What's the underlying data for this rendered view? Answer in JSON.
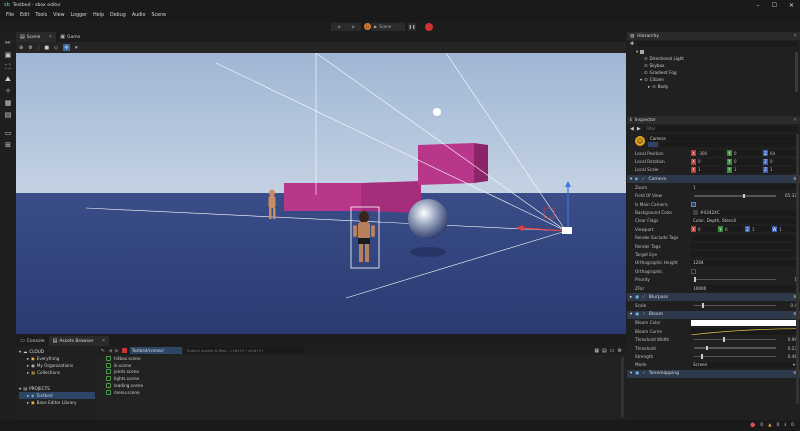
{
  "window": {
    "title": "Testbed - sbox editor"
  },
  "menu": [
    "File",
    "Edit",
    "Tools",
    "View",
    "Logger",
    "Help",
    "Debug",
    "Audio",
    "Scene"
  ],
  "playbar": {
    "scene_label": "Scene"
  },
  "viewport": {
    "tabs": [
      {
        "label": "Scene"
      },
      {
        "label": "Game"
      }
    ]
  },
  "bottom": {
    "tabs": [
      {
        "label": "Console"
      },
      {
        "label": "Assets Browser"
      }
    ],
    "path": "Testbed/scenes/",
    "search_placeholder": "Search assets & files... (ctrl+F / cmd+F)",
    "left": {
      "cloud_label": "CLOUD",
      "cloud_items": [
        "Everything",
        "My Organizations",
        "Collections"
      ],
      "projects_label": "PROJECTS",
      "project_items": [
        "Testbed",
        "Base Editor Library"
      ]
    },
    "files": [
      "hitbox.scene",
      "ik.scene",
      "joints.scene",
      "lights.scene",
      "loading.scene",
      "menu.scene"
    ]
  },
  "hierarchy": {
    "title": "Hierarchy",
    "items": [
      {
        "label": "Directional Light",
        "indent": 2
      },
      {
        "label": "Skybox",
        "indent": 2
      },
      {
        "label": "Gradient Fog",
        "indent": 2
      },
      {
        "label": "Citizen",
        "indent": 1
      },
      {
        "label": "Body",
        "indent": 2
      }
    ]
  },
  "inspector": {
    "title": "Inspector",
    "filter_placeholder": "Filter",
    "object_name": "Camera",
    "transform": [
      {
        "label": "Local Position",
        "x": "-300",
        "y": "0",
        "z": "64"
      },
      {
        "label": "Local Rotation",
        "x": "0",
        "y": "0",
        "z": "0"
      },
      {
        "label": "Local Scale",
        "x": "1",
        "y": "1",
        "z": "1"
      }
    ],
    "camera": {
      "title": "Camera",
      "props": [
        {
          "label": "Zoom",
          "value": "1"
        },
        {
          "label": "Field Of View",
          "value": "65.32",
          "slider": 0.6
        },
        {
          "label": "Is Main Camera",
          "check": true
        },
        {
          "label": "Background Color",
          "value": "#43424C",
          "swatch": "#43424C"
        },
        {
          "label": "Clear Flags",
          "value": "Color, Depth, Stencil"
        },
        {
          "label": "Viewport",
          "xyzw": [
            "0",
            "0",
            "1",
            "1"
          ]
        },
        {
          "label": "Render Exclude Tags",
          "value": ""
        },
        {
          "label": "Render Tags",
          "value": ""
        },
        {
          "label": "Target Eye",
          "value": ""
        },
        {
          "label": "Orthographic Height",
          "value": "1204"
        },
        {
          "label": "Orthographic",
          "check": false
        },
        {
          "label": "Priority",
          "value": "1",
          "slider": 0.0
        },
        {
          "label": "ZFar",
          "value": "10000"
        }
      ]
    },
    "bloom_filter": {
      "title": "Blurpass",
      "scale_label": "Scale",
      "scale_value": "0.4",
      "scale_fill": 0.1
    },
    "bloom": {
      "title": "Bloom",
      "color_label": "Bloom Color",
      "curve_label": "Bloom Curve",
      "props": [
        {
          "label": "Threshold Width",
          "value": "0.96",
          "fill": 0.35
        },
        {
          "label": "Threshold",
          "value": "0.23",
          "fill": 0.15
        },
        {
          "label": "Strength",
          "value": "0.48",
          "fill": 0.08
        }
      ],
      "mode_label": "Mode",
      "mode_value": "Screen"
    },
    "tonemapping": {
      "title": "Tonemapping"
    }
  },
  "status": {
    "errors": "0",
    "warnings": "0",
    "messages": "0"
  }
}
